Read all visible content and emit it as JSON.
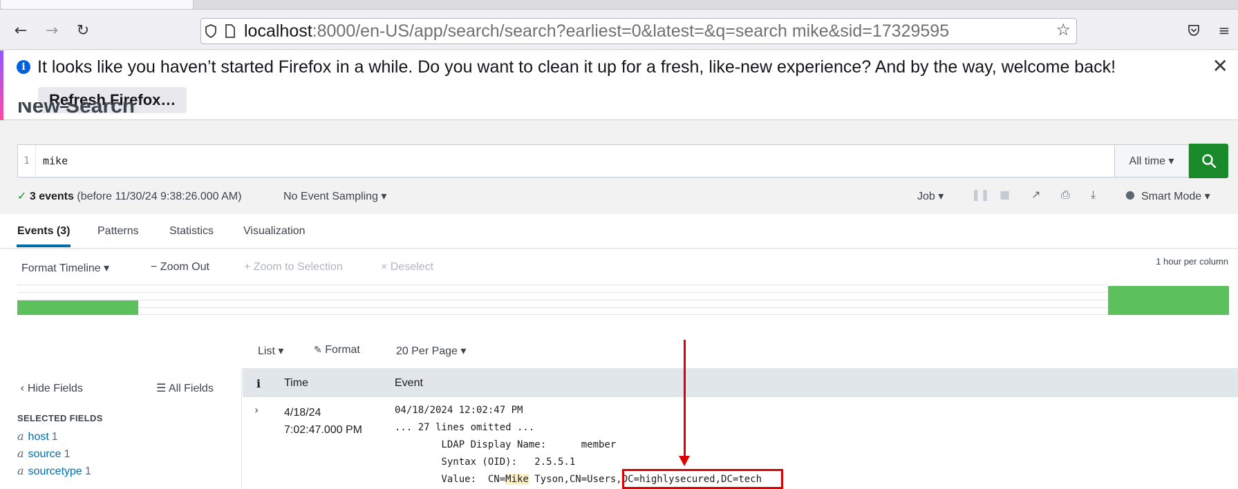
{
  "browser": {
    "url_host": "localhost",
    "url_rest": ":8000/en-US/app/search/search?earliest=0&latest=&q=search mike&sid=17329595",
    "icons": {
      "back": "arrow-left-icon",
      "forward": "arrow-right-icon",
      "reload": "reload-icon",
      "shield": "shield-icon",
      "page": "page-icon",
      "star": "star-icon",
      "pocket": "pocket-icon",
      "menu": "hamburger-menu-icon"
    }
  },
  "notification": {
    "message": "It looks like you haven’t started Firefox in a while. Do you want to clean it up for a fresh, like-new experience? And by the way, welcome back!",
    "button_pre": "R",
    "button_underlined": "e",
    "button_post": "fresh Firefox…"
  },
  "search": {
    "page_title": "New Search",
    "line_number": "1",
    "query": "mike",
    "time_range": "All time ▾"
  },
  "status": {
    "count": "3 events",
    "detail": "(before 11/30/24 9:38:26.000 AM)",
    "sampling": "No Event Sampling ▾",
    "job": "Job ▾",
    "mode": "Smart Mode ▾"
  },
  "tabs": [
    {
      "label": "Events (3)",
      "active": true
    },
    {
      "label": "Patterns",
      "active": false
    },
    {
      "label": "Statistics",
      "active": false
    },
    {
      "label": "Visualization",
      "active": false
    }
  ],
  "timeline": {
    "format": "Format Timeline ▾",
    "zoom_out": "− Zoom Out",
    "zoom_selection": "+ Zoom to Selection",
    "deselect": "× Deselect",
    "scale": "1 hour per column",
    "accent": "#5cc05c"
  },
  "results": {
    "list": "List ▾",
    "format": "Format",
    "per_page": "20 Per Page ▾"
  },
  "fields": {
    "hide": "Hide Fields",
    "all": "All Fields",
    "selected_title": "SELECTED FIELDS",
    "items": [
      {
        "type": "a",
        "name": "host",
        "count": "1"
      },
      {
        "type": "a",
        "name": "source",
        "count": "1"
      },
      {
        "type": "a",
        "name": "sourcetype",
        "count": "1"
      }
    ]
  },
  "table": {
    "col_info": "i",
    "col_time": "Time",
    "col_event": "Event",
    "row": {
      "time_date": "4/18/24",
      "time_clock": "7:02:47.000 PM",
      "line1": "04/18/2024 12:02:47 PM",
      "line2": "... 27 lines omitted ...",
      "line3": "        LDAP Display Name:      member",
      "line4": "        Syntax (OID):   2.5.5.1",
      "line5_pre": "        Value:  CN=",
      "line5_hl": "Mike",
      "line5_post": " Tyson,CN=Users,DC=highlysecured,DC=tech"
    }
  }
}
